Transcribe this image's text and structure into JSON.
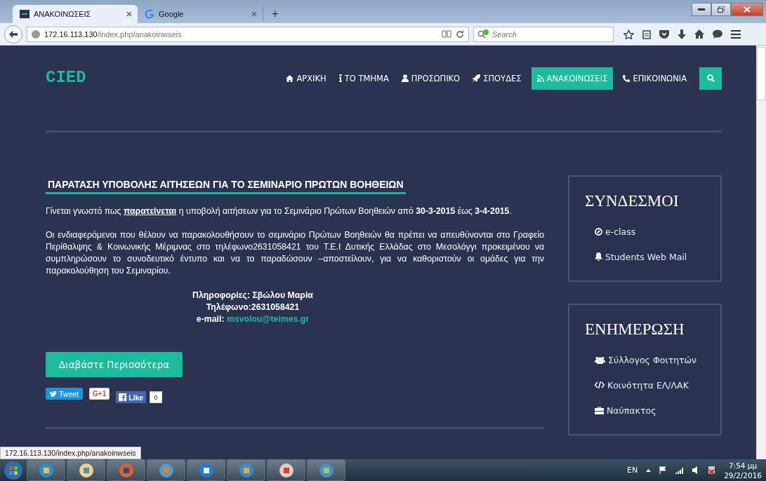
{
  "browser": {
    "tabs": [
      {
        "title": "ΑΝΑΚΟΙΝΩΣΕΙΣ",
        "selected": true
      },
      {
        "title": "Google",
        "selected": false
      }
    ],
    "new_tab": "+",
    "url_host": "172.16.113.130",
    "url_path": "/index.php/anakoinwseis",
    "search": {
      "placeholder": "Search"
    }
  },
  "site": {
    "logo": "CIED",
    "nav": [
      {
        "label": "ΑΡΧΙΚΗ",
        "selected": false
      },
      {
        "label": "ΤΟ ΤΜΗΜΑ",
        "selected": false
      },
      {
        "label": "ΠΡΟΣΩΠΙΚΟ",
        "selected": false
      },
      {
        "label": "ΣΠΟΥΔΕΣ",
        "selected": false
      },
      {
        "label": "ΑΝΑΚΟΙΝΩΣΕΙΣ",
        "selected": true
      },
      {
        "label": "ΕΠΙΚΟΙΝΩΝΙΑ",
        "selected": false
      }
    ],
    "article": {
      "title": "ΠΑΡΑΤΑΣΗ ΥΠΟΒΟΛΗΣ ΑΙΤΗΣΕΩΝ ΓΙΑ ΤΟ ΣΕΜΙΝΑΡΙΟ ΠΡΩΤΩΝ ΒΟΗΘΕΙΩΝ",
      "paragraphs": [
        "Γίνεται γνωστό πως **παρατείνεται** η υποβολή αιτήσεων για το Σεμινάριο Πρώτων Βοηθειών από **30-3-2015** έως **3-4-2015**.",
        "Οι ενδιαφερόμενοι που θέλουν  να παρακολουθήσουν το σεμινάριο Πρώτων Βοηθειών θα  πρέπει να απευθύνονται στο Γραφείο Περίθαλψης & Κοινωνικής Μέριμνας  στο τηλέφωνο2631058421 του Τ.Ε.Ι Δυτικής Ελλάδας στο Μεσολόγγι προκειμένου να συμπληρώσουν το συνοδευτικό  έντυπο  και να το  παραδώσουν –αποστείλουν,  για  να καθοριστούν οι  ομάδες  για  την  παρακολούθηση του Σεμιναρίου."
      ],
      "info": [
        "Πληροφορίες: Σβώλου Μαρία",
        "Τηλέφωνο:2631058421"
      ],
      "email_label": "e-mail:",
      "email": "msvolou@teimes.gr"
    },
    "read_more": "Διαβάστε Περισσότερα",
    "social": {
      "tweet": "Tweet",
      "gplus": "G+1",
      "like": "Like",
      "like_count": "0"
    },
    "panels": [
      {
        "title": "ΣΥΝΔΕΣΜΟΙ",
        "links": [
          "e-class",
          "Students Web Mail"
        ]
      },
      {
        "title": "ΕΝΗΜΕΡΩΣΗ",
        "links": [
          "Σύλλογος Φοιτητών",
          "Κοινότητα ΕΛ/ΛΑΚ",
          "Ναύπακτος"
        ]
      }
    ]
  },
  "status_url": "172.16.113.130/index.php/anakoinwseis",
  "taskbar": {
    "language": "EN",
    "time": "7:54 μμ",
    "date": "29/2/2016"
  }
}
